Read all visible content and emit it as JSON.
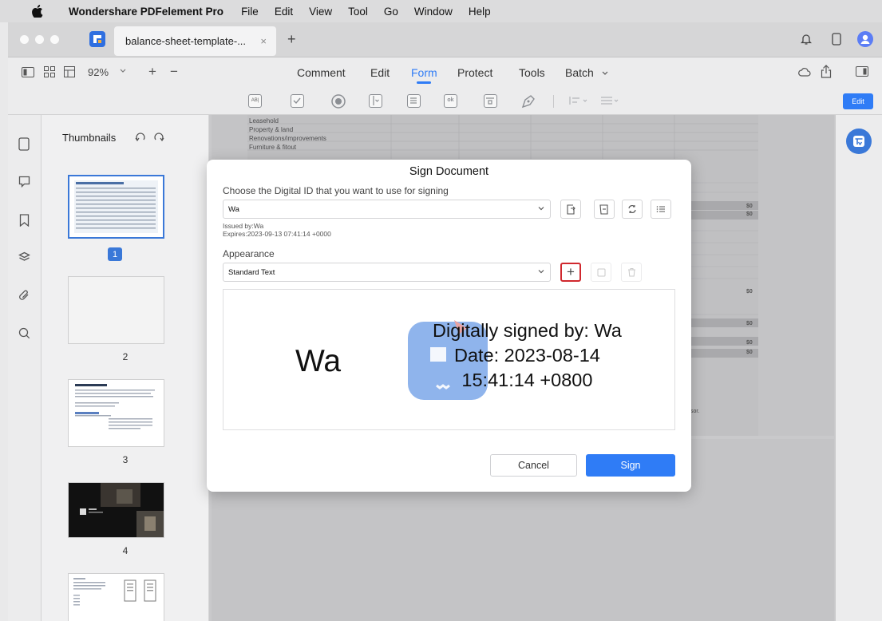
{
  "menubar": {
    "app_name": "Wondershare PDFelement Pro",
    "items": [
      "File",
      "Edit",
      "View",
      "Tool",
      "Go",
      "Window",
      "Help"
    ]
  },
  "tabbar": {
    "tab_title": "balance-sheet-template-...",
    "close_symbol": "×",
    "new_tab_symbol": "+"
  },
  "toolbar": {
    "zoom": "92%",
    "zoom_in": "+",
    "zoom_out": "−",
    "tabs": [
      "Comment",
      "Edit",
      "Form",
      "Protect",
      "Tools",
      "Batch"
    ],
    "active_tab": "Form",
    "edit_button": "Edit"
  },
  "sidebar_icons": [
    "page-icon",
    "comment-icon",
    "bookmark-icon",
    "layers-icon",
    "attachment-icon",
    "search-icon"
  ],
  "thumbnails": {
    "title": "Thumbnails",
    "pages": [
      "1",
      "2",
      "3",
      "4"
    ],
    "selected": "1"
  },
  "document": {
    "rows": [
      "Leasehold",
      "Property & land",
      "Renovations/improvements",
      "Furniture & fitout"
    ],
    "values": [
      "$0",
      "$0",
      "$0",
      "$0",
      "$0",
      "$0"
    ],
    "note": "sor."
  },
  "dialog": {
    "title": "Sign Document",
    "digital_id_label": "Choose the Digital ID that you want to use for signing",
    "digital_id_value": "Wa",
    "issued_by": "Issued by:Wa",
    "expires": "Expires:2023-09-13 07:41:14 +0000",
    "appearance_label": "Appearance",
    "appearance_value": "Standard Text",
    "add_symbol": "+",
    "preview": {
      "name": "Wa",
      "line1": "Digitally signed by: Wa",
      "line2": "Date: 2023-08-14",
      "line3": "15:41:14 +0800"
    },
    "cancel_label": "Cancel",
    "sign_label": "Sign"
  },
  "colors": {
    "accent": "#2f7cf6",
    "highlight_box": "#d0282e",
    "badge": "#3a78d8"
  }
}
